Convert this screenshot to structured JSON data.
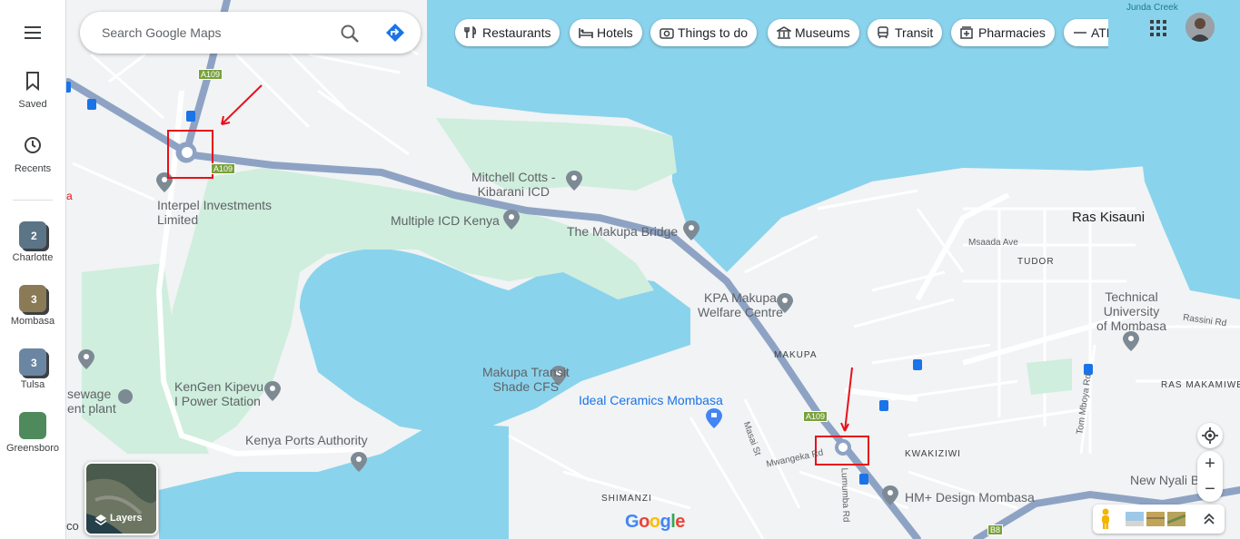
{
  "search": {
    "placeholder": "Search Google Maps"
  },
  "sidebar": {
    "saved_label": "Saved",
    "recents_label": "Recents",
    "lists": [
      {
        "name": "Charlotte",
        "count": "2",
        "color": "#5b7486"
      },
      {
        "name": "Mombasa",
        "count": "3",
        "color": "#8a7a55"
      },
      {
        "name": "Tulsa",
        "count": "3",
        "color": "#6b86a3"
      },
      {
        "name": "Greensboro",
        "count": "",
        "color": "#4e8a5c"
      }
    ]
  },
  "chips": [
    {
      "label": "Restaurants",
      "icon": "restaurant-icon"
    },
    {
      "label": "Hotels",
      "icon": "hotel-icon"
    },
    {
      "label": "Things to do",
      "icon": "camera-icon"
    },
    {
      "label": "Museums",
      "icon": "museum-icon"
    },
    {
      "label": "Transit",
      "icon": "transit-icon"
    },
    {
      "label": "Pharmacies",
      "icon": "pharmacy-icon"
    },
    {
      "label": "ATMs",
      "icon": "atm-icon"
    }
  ],
  "map": {
    "labels": {
      "junda": "Junda Creek",
      "interpel_1": "Interpel Investments",
      "interpel_2": "Limited",
      "mitchell_1": "Mitchell Cotts -",
      "mitchell_2": "Kibarani ICD",
      "multiple_icd": "Multiple ICD Kenya",
      "makupa_bridge": "The Makupa Bridge",
      "ras_kisauni": "Ras Kisauni",
      "msaada": "Msaada Ave",
      "tudor": "TUDOR",
      "technical_1": "Technical",
      "technical_2": "University",
      "technical_3": "of Mombasa",
      "rassini": "Rassini Rd",
      "kpa_1": "KPA Makupa",
      "kpa_2": "Welfare Centre",
      "makupa": "MAKUPA",
      "transit_shade_1": "Makupa Transit",
      "transit_shade_2": "Shade CFS",
      "ideal": "Ideal Ceramics Mombasa",
      "sewage_1": "sewage",
      "sewage_2": "ent plant",
      "kengen_1": "KenGen Kipevu",
      "kengen_2": "I Power Station",
      "ports": "Kenya Ports Authority",
      "masai": "Masai St",
      "mwangeka": "Mwangeka Rd",
      "lumumba": "Lumumba Rd",
      "kwakiziwi": "KWAKIZIWI",
      "tom_mboya": "Tom Mboya Rd",
      "ras_makamaiwe": "RAS MAKAMIWE",
      "hm_design": "HM+ Design Mombasa",
      "new_nyali": "New Nyali B",
      "shimanzi": "SHIMANZI",
      "a109": "A109",
      "b8": "B8",
      "edge_a": "a",
      "edge_co": "co"
    },
    "layers_label": "Layers",
    "google_logo": "Google"
  },
  "colors": {
    "water": "#8ad3ec",
    "land": "#f1f3f4",
    "park": "#cfeedd",
    "highway": "#8ea3c4",
    "annotation": "#e8101a"
  }
}
